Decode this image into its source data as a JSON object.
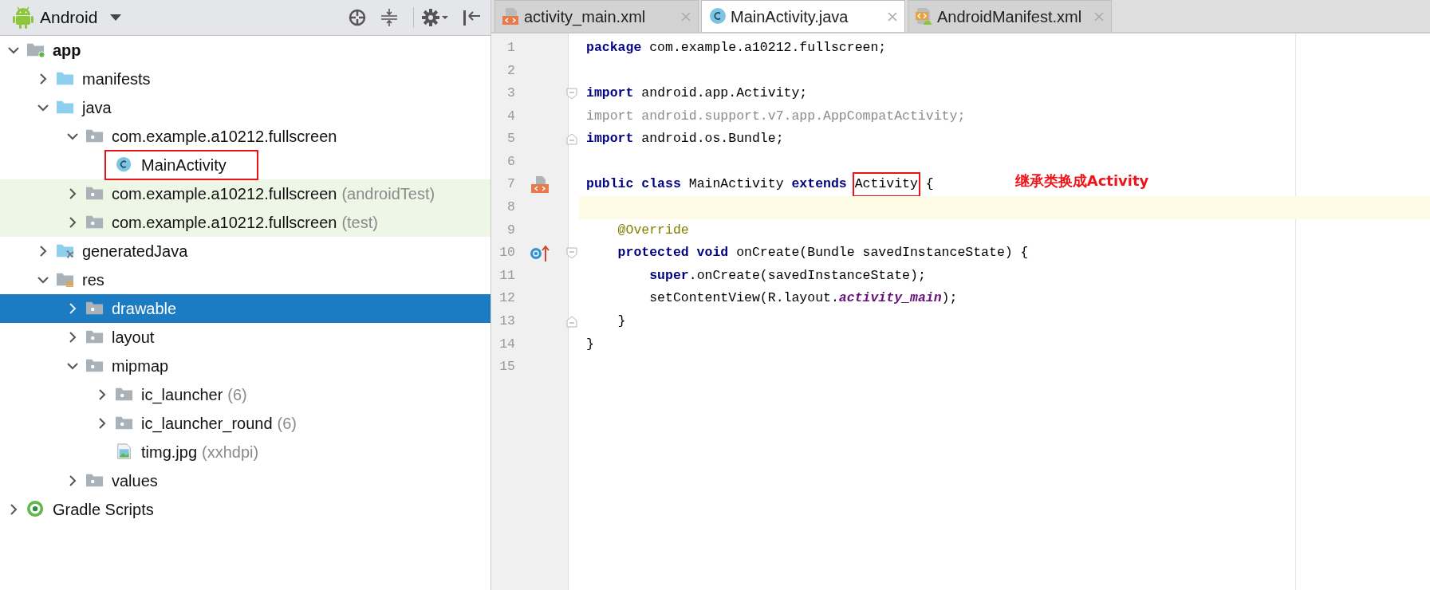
{
  "project_view": {
    "title": "Android",
    "tree": [
      {
        "label": "app",
        "kind": "module",
        "expanded": true,
        "selected": false,
        "tinted": false,
        "children": [
          {
            "label": "manifests",
            "kind": "folder",
            "expanded": false,
            "selected": false,
            "tinted": false
          },
          {
            "label": "java",
            "kind": "folder",
            "expanded": true,
            "selected": false,
            "tinted": false,
            "children": [
              {
                "label": "com.example.a10212.fullscreen",
                "kind": "package",
                "expanded": true,
                "selected": false,
                "tinted": false,
                "children": [
                  {
                    "label": "MainActivity",
                    "kind": "class",
                    "selected": false,
                    "tinted": false,
                    "boxed": true
                  }
                ]
              },
              {
                "label": "com.example.a10212.fullscreen",
                "suffix": "(androidTest)",
                "kind": "package",
                "expanded": false,
                "selected": false,
                "tinted": true
              },
              {
                "label": "com.example.a10212.fullscreen",
                "suffix": "(test)",
                "kind": "package",
                "expanded": false,
                "selected": false,
                "tinted": true
              }
            ]
          },
          {
            "label": "generatedJava",
            "kind": "generated",
            "expanded": false,
            "selected": false,
            "tinted": false
          },
          {
            "label": "res",
            "kind": "res",
            "expanded": true,
            "selected": false,
            "tinted": false,
            "children": [
              {
                "label": "drawable",
                "kind": "package",
                "expanded": false,
                "selected": true,
                "tinted": false
              },
              {
                "label": "layout",
                "kind": "package",
                "expanded": false,
                "selected": false,
                "tinted": false
              },
              {
                "label": "mipmap",
                "kind": "package",
                "expanded": true,
                "selected": false,
                "tinted": false,
                "children": [
                  {
                    "label": "ic_launcher",
                    "suffix": "(6)",
                    "kind": "package",
                    "expanded": false,
                    "selected": false,
                    "tinted": false
                  },
                  {
                    "label": "ic_launcher_round",
                    "suffix": "(6)",
                    "kind": "package",
                    "expanded": false,
                    "selected": false,
                    "tinted": false
                  },
                  {
                    "label": "timg.jpg",
                    "suffix": "(xxhdpi)",
                    "kind": "image",
                    "selected": false,
                    "tinted": false
                  }
                ]
              },
              {
                "label": "values",
                "kind": "package",
                "expanded": false,
                "selected": false,
                "tinted": false
              }
            ]
          }
        ]
      },
      {
        "label": "Gradle Scripts",
        "kind": "gradle",
        "expanded": false,
        "selected": false,
        "tinted": false
      }
    ]
  },
  "editor": {
    "tabs": [
      {
        "label": "activity_main.xml",
        "kind": "xml",
        "selected": false
      },
      {
        "label": "MainActivity.java",
        "kind": "class",
        "selected": true
      },
      {
        "label": "AndroidManifest.xml",
        "kind": "manifest",
        "selected": false
      }
    ],
    "lines": [
      {
        "number": "1",
        "kind": "plain",
        "current": false,
        "tokens": [
          {
            "text": "package",
            "kind": "keyword"
          },
          {
            "text": " com.example.a10212.fullscreen;",
            "kind": "plain"
          }
        ]
      },
      {
        "number": "2",
        "kind": "plain",
        "current": false
      },
      {
        "number": "3",
        "kind": "foldstart",
        "current": false,
        "tokens": [
          {
            "text": "import",
            "kind": "keyword"
          },
          {
            "text": " android.app.Activity;",
            "kind": "plain"
          }
        ]
      },
      {
        "number": "4",
        "kind": "plain",
        "current": false,
        "tokens": [
          {
            "text": "import android.support.v7.app.AppCompatActivity;",
            "kind": "unused"
          }
        ]
      },
      {
        "number": "5",
        "kind": "foldend",
        "current": false,
        "tokens": [
          {
            "text": "import",
            "kind": "keyword"
          },
          {
            "text": " android.os.Bundle;",
            "kind": "plain"
          }
        ]
      },
      {
        "number": "6",
        "kind": "plain",
        "current": false
      },
      {
        "number": "7",
        "kind": "layout",
        "current": false,
        "tokens": [
          {
            "text": "public class",
            "kind": "keyword"
          },
          {
            "text": " MainActivity ",
            "kind": "plain"
          },
          {
            "text": "extends ",
            "kind": "keyword"
          },
          {
            "text": "Activity",
            "kind": "plain",
            "boxed": true
          },
          {
            "text": " {",
            "kind": "plain"
          }
        ],
        "note": "继承类换成Activity"
      },
      {
        "number": "8",
        "kind": "plain",
        "current": true
      },
      {
        "number": "9",
        "kind": "plain",
        "current": false,
        "tokens": [
          {
            "text": "    @Override",
            "kind": "annotation"
          }
        ]
      },
      {
        "number": "10",
        "kind": "override",
        "current": false,
        "tokens": [
          {
            "text": "    protected void",
            "kind": "keyword"
          },
          {
            "text": " onCreate(Bundle savedInstanceState) {",
            "kind": "plain"
          }
        ]
      },
      {
        "number": "11",
        "kind": "plain",
        "current": false,
        "tokens": [
          {
            "text": "        super",
            "kind": "keyword"
          },
          {
            "text": ".onCreate(savedInstanceState);",
            "kind": "plain"
          }
        ]
      },
      {
        "number": "12",
        "kind": "plain",
        "current": false,
        "tokens": [
          {
            "text": "        setContentView(R.layout.",
            "kind": "plain"
          },
          {
            "text": "activity_main",
            "kind": "static_field"
          },
          {
            "text": ");",
            "kind": "plain"
          }
        ]
      },
      {
        "number": "13",
        "kind": "foldend",
        "current": false,
        "tokens": [
          {
            "text": "    }",
            "kind": "plain"
          }
        ]
      },
      {
        "number": "14",
        "kind": "plain",
        "current": false,
        "tokens": [
          {
            "text": "}",
            "kind": "plain"
          }
        ]
      },
      {
        "number": "15",
        "kind": "plain",
        "current": false
      }
    ]
  }
}
